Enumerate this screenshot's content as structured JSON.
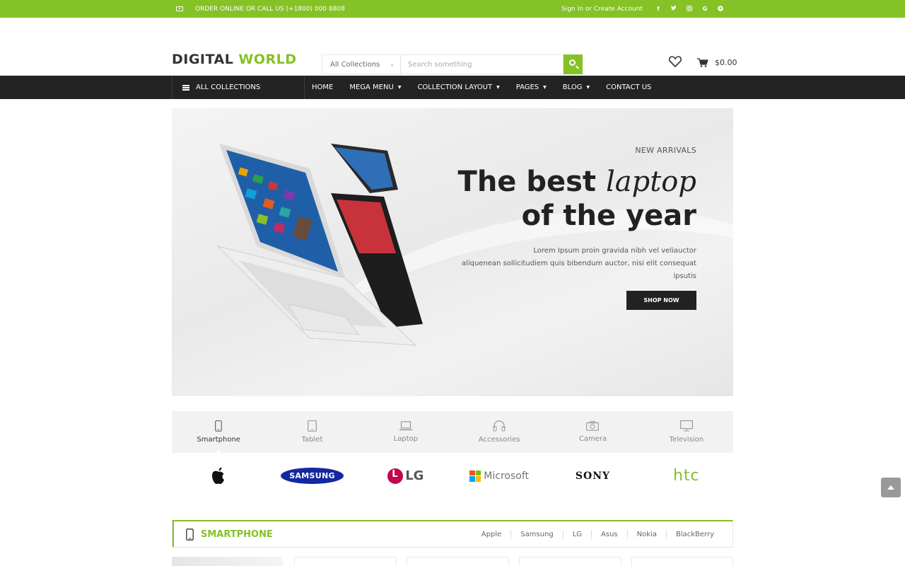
{
  "topbar": {
    "contact": "ORDER ONLINE OR CALL US (+1800) 000 8808",
    "account": "Sign In or Create Account",
    "social": [
      "facebook-icon",
      "twitter-icon",
      "instagram-icon",
      "google-icon",
      "pinterest-icon"
    ]
  },
  "header": {
    "logo_main": "DIGITAL ",
    "logo_accent": "WORLD",
    "search": {
      "collection": "All Collections",
      "placeholder": "Search something"
    },
    "cart_total": "$0.00"
  },
  "nav": {
    "all_collections": "ALL COLLECTIONS",
    "items": [
      {
        "label": "HOME",
        "dropdown": false
      },
      {
        "label": "MEGA MENU",
        "dropdown": true
      },
      {
        "label": "COLLECTION LAYOUT",
        "dropdown": true
      },
      {
        "label": "PAGES",
        "dropdown": true
      },
      {
        "label": "BLOG",
        "dropdown": true
      },
      {
        "label": "CONTACT US",
        "dropdown": false
      }
    ]
  },
  "hero": {
    "eyebrow": "NEW ARRIVALS",
    "title_line1_a": "The best ",
    "title_line1_b": "laptop",
    "title_line2": "of the year",
    "desc_line1": "Lorem Ipsum proin gravida nibh vel veliauctor",
    "desc_line2": "aliquenean sollicitudiem quis bibendum auctor, nisi elit consequat ipsutis",
    "button": "SHOP NOW"
  },
  "categories": [
    {
      "label": "Smartphone",
      "icon": "smartphone-icon",
      "active": true
    },
    {
      "label": "Tablet",
      "icon": "tablet-icon",
      "active": false
    },
    {
      "label": "Laptop",
      "icon": "laptop-icon",
      "active": false
    },
    {
      "label": "Accessories",
      "icon": "headphones-icon",
      "active": false
    },
    {
      "label": "Camera",
      "icon": "camera-icon",
      "active": false
    },
    {
      "label": "Television",
      "icon": "television-icon",
      "active": false
    }
  ],
  "brands": {
    "samsung": "SAMSUNG",
    "lg": "LG",
    "microsoft": "Microsoft",
    "sony": "SONY",
    "htc": "htc"
  },
  "section": {
    "title": "SMARTPHONE",
    "subs": [
      "Apple",
      "Samsung",
      "LG",
      "Asus",
      "Nokia",
      "BlackBerry"
    ]
  },
  "colors": {
    "accent": "#84c225",
    "nav_bg": "#232323"
  }
}
